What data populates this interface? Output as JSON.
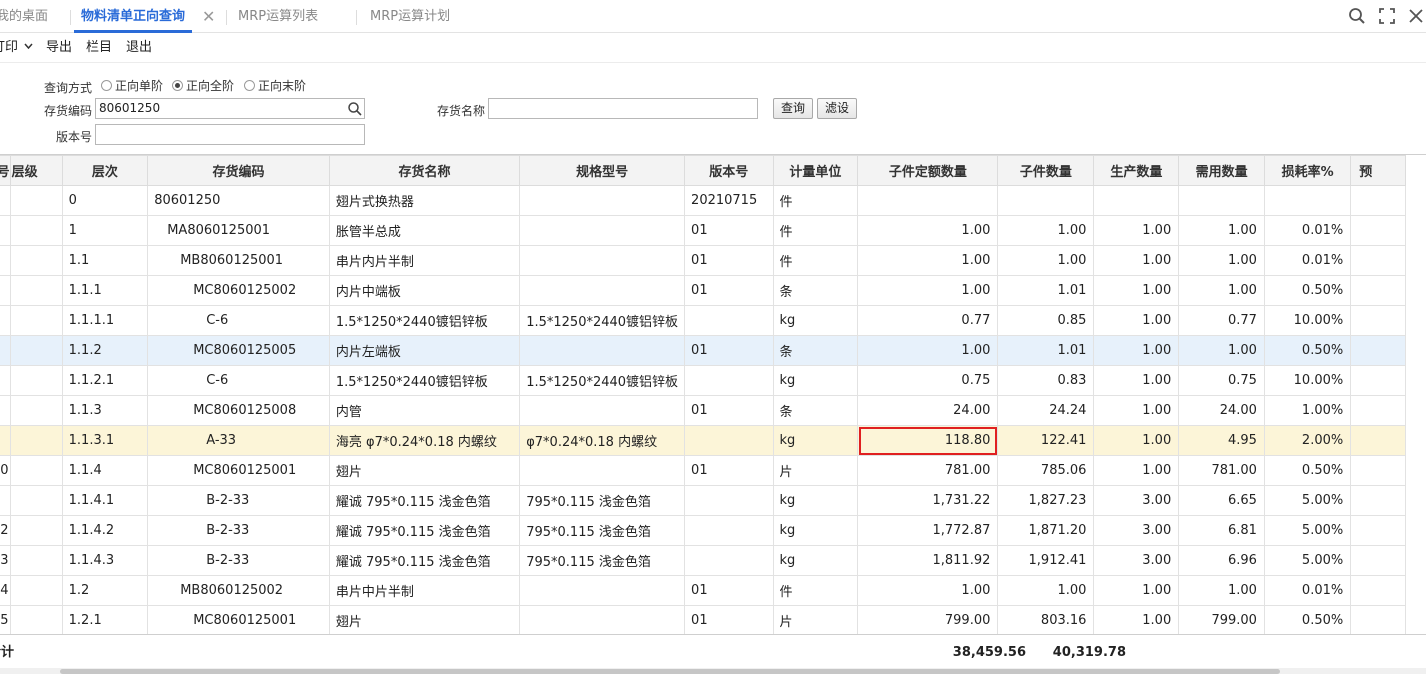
{
  "tabs": [
    {
      "label": "我的桌面"
    },
    {
      "label": "物料清单正向查询"
    },
    {
      "label": "MRP运算列表"
    },
    {
      "label": "MRP运算计划"
    }
  ],
  "tab_close_glyph": "✕",
  "toolbar": {
    "print_label": "打印",
    "export_label": "导出",
    "columns_label": "栏目",
    "exit_label": "退出"
  },
  "query": {
    "mode_label": "查询方式",
    "modes": [
      {
        "label": "正向单阶",
        "checked": false
      },
      {
        "label": "正向全阶",
        "checked": true
      },
      {
        "label": "正向末阶",
        "checked": false
      }
    ],
    "code_label": "存货编码",
    "code_value": "80601250",
    "name_label": "存货名称",
    "name_value": "",
    "version_label": "版本号",
    "version_value": "",
    "query_button": "查询",
    "filter_button": "滤设"
  },
  "table": {
    "headers": [
      "序号",
      "层级",
      "层次",
      "存货编码",
      "存货名称",
      "规格型号",
      "版本号",
      "计量单位",
      "子件定额数量",
      "子件数量",
      "生产数量",
      "需用数量",
      "损耗率%",
      "预"
    ],
    "rows": [
      {
        "seq": "",
        "lvl": "",
        "level": "0",
        "code": "80601250",
        "name": "翅片式换热器",
        "spec": "",
        "ver": "20210715",
        "unit": "件",
        "quota": "",
        "qty": "",
        "prod": "",
        "need": "",
        "loss": ""
      },
      {
        "seq": "",
        "lvl": "",
        "level": "1",
        "code": "MA8060125001",
        "name": "胀管半总成",
        "spec": "",
        "ver": "01",
        "unit": "件",
        "quota": "1.00",
        "qty": "1.00",
        "prod": "1.00",
        "need": "1.00",
        "loss": "0.01%"
      },
      {
        "seq": "",
        "lvl": "",
        "level": "1.1",
        "code": "MB8060125001",
        "name": "串片内片半制",
        "spec": "",
        "ver": "01",
        "unit": "件",
        "quota": "1.00",
        "qty": "1.00",
        "prod": "1.00",
        "need": "1.00",
        "loss": "0.01%"
      },
      {
        "seq": "",
        "lvl": "",
        "level": "1.1.1",
        "code": "MC8060125002",
        "name": "内片中端板",
        "spec": "",
        "ver": "01",
        "unit": "条",
        "quota": "1.00",
        "qty": "1.01",
        "prod": "1.00",
        "need": "1.00",
        "loss": "0.50%"
      },
      {
        "seq": "",
        "lvl": "",
        "level": "1.1.1.1",
        "code": "C-6",
        "name": "1.5*1250*2440镀铝锌板",
        "spec": "1.5*1250*2440镀铝锌板",
        "ver": "",
        "unit": "kg",
        "quota": "0.77",
        "qty": "0.85",
        "prod": "1.00",
        "need": "0.77",
        "loss": "10.00%"
      },
      {
        "seq": "",
        "lvl": "",
        "level": "1.1.2",
        "code": "MC8060125005",
        "name": "内片左端板",
        "spec": "",
        "ver": "01",
        "unit": "条",
        "quota": "1.00",
        "qty": "1.01",
        "prod": "1.00",
        "need": "1.00",
        "loss": "0.50%"
      },
      {
        "seq": "",
        "lvl": "",
        "level": "1.1.2.1",
        "code": "C-6",
        "name": "1.5*1250*2440镀铝锌板",
        "spec": "1.5*1250*2440镀铝锌板",
        "ver": "",
        "unit": "kg",
        "quota": "0.75",
        "qty": "0.83",
        "prod": "1.00",
        "need": "0.75",
        "loss": "10.00%"
      },
      {
        "seq": "",
        "lvl": "",
        "level": "1.1.3",
        "code": "MC8060125008",
        "name": "内管",
        "spec": "",
        "ver": "01",
        "unit": "条",
        "quota": "24.00",
        "qty": "24.24",
        "prod": "1.00",
        "need": "24.00",
        "loss": "1.00%"
      },
      {
        "seq": "",
        "lvl": "",
        "level": "1.1.3.1",
        "code": "A-33",
        "name": "海亮 φ7*0.24*0.18 内螺纹",
        "spec": "φ7*0.24*0.18 内螺纹",
        "ver": "",
        "unit": "kg",
        "quota": "118.80",
        "qty": "122.41",
        "prod": "1.00",
        "need": "4.95",
        "loss": "2.00%"
      },
      {
        "seq": "0",
        "lvl": "",
        "level": "1.1.4",
        "code": "MC8060125001",
        "name": "翅片",
        "spec": "",
        "ver": "01",
        "unit": "片",
        "quota": "781.00",
        "qty": "785.06",
        "prod": "1.00",
        "need": "781.00",
        "loss": "0.50%"
      },
      {
        "seq": "",
        "lvl": "",
        "level": "1.1.4.1",
        "code": "B-2-33",
        "name": "耀诚 795*0.115 浅金色箔",
        "spec": "795*0.115 浅金色箔",
        "ver": "",
        "unit": "kg",
        "quota": "1,731.22",
        "qty": "1,827.23",
        "prod": "3.00",
        "need": "6.65",
        "loss": "5.00%"
      },
      {
        "seq": "2",
        "lvl": "",
        "level": "1.1.4.2",
        "code": "B-2-33",
        "name": "耀诚 795*0.115 浅金色箔",
        "spec": "795*0.115 浅金色箔",
        "ver": "",
        "unit": "kg",
        "quota": "1,772.87",
        "qty": "1,871.20",
        "prod": "3.00",
        "need": "6.81",
        "loss": "5.00%"
      },
      {
        "seq": "3",
        "lvl": "",
        "level": "1.1.4.3",
        "code": "B-2-33",
        "name": "耀诚 795*0.115 浅金色箔",
        "spec": "795*0.115 浅金色箔",
        "ver": "",
        "unit": "kg",
        "quota": "1,811.92",
        "qty": "1,912.41",
        "prod": "3.00",
        "need": "6.96",
        "loss": "5.00%"
      },
      {
        "seq": "4",
        "lvl": "",
        "level": "1.2",
        "code": "MB8060125002",
        "name": "串片中片半制",
        "spec": "",
        "ver": "01",
        "unit": "件",
        "quota": "1.00",
        "qty": "1.00",
        "prod": "1.00",
        "need": "1.00",
        "loss": "0.01%"
      },
      {
        "seq": "5",
        "lvl": "",
        "level": "1.2.1",
        "code": "MC8060125001",
        "name": "翅片",
        "spec": "",
        "ver": "01",
        "unit": "片",
        "quota": "799.00",
        "qty": "803.16",
        "prod": "1.00",
        "need": "799.00",
        "loss": "0.50%"
      }
    ],
    "selected_row_index": 5,
    "warning_row_index": 8,
    "highlight_color": "#e02020"
  },
  "footer": {
    "label": "合计",
    "quota_total": "38,459.56",
    "qty_total": "40,319.78"
  },
  "colors": {
    "accent": "#2a6bd8",
    "selected_row": "#e7f1fb",
    "warning_row": "#fcf5d8"
  }
}
